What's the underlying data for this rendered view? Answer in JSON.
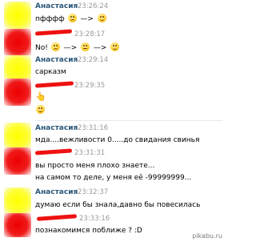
{
  "messages": [
    {
      "sender": "Анастасия",
      "time": "23:26:24",
      "lines": [
        {
          "text": "пфффф",
          "emoji": [
            "sad-face-icon",
            "arrow",
            "smile-face-icon"
          ]
        }
      ]
    },
    {
      "sender": "",
      "time": "23:28:17",
      "lines": [
        {
          "text": "No!",
          "emoji": [
            "sad-face-icon",
            "arrow",
            "flat-face-icon",
            "arrow",
            "laugh-face-icon"
          ]
        }
      ]
    },
    {
      "sender": "Анастасия",
      "time": "23:29:14",
      "lines": [
        {
          "text": "сарказм"
        }
      ]
    },
    {
      "sender": "",
      "time": "23:29:35",
      "lines": [
        {
          "text": "",
          "emoji": [
            "pointing-hand-icon"
          ]
        },
        {
          "text": "",
          "emoji": [
            "smile-face-icon"
          ]
        }
      ]
    },
    {
      "sender": "Анастасия",
      "time": "23:31:16",
      "lines": [
        {
          "text": "мда....вежливости 0.....до свидания свинья"
        }
      ]
    },
    {
      "sender": "",
      "time": "23:31:31",
      "lines": [
        {
          "text": "вы просто меня плохо знаете..."
        },
        {
          "text": "на самом то деле, у меня её -99999999..."
        }
      ]
    },
    {
      "sender": "Анастасия",
      "time": "23:32:37",
      "lines": [
        {
          "text": "думаю если бы знала,давно бы повесилась"
        }
      ]
    },
    {
      "sender": "",
      "time": "23:33:16",
      "lines": [
        {
          "text": "познакомимся поближе ? :D"
        }
      ]
    }
  ],
  "arrow_glyph": "—>",
  "hand_glyph": "👆",
  "watermark": "pikabu.ru",
  "colors": {
    "sender": "#2b587a",
    "time": "#999999",
    "redaction": "#ee0000",
    "highlight": "#ffff00"
  }
}
